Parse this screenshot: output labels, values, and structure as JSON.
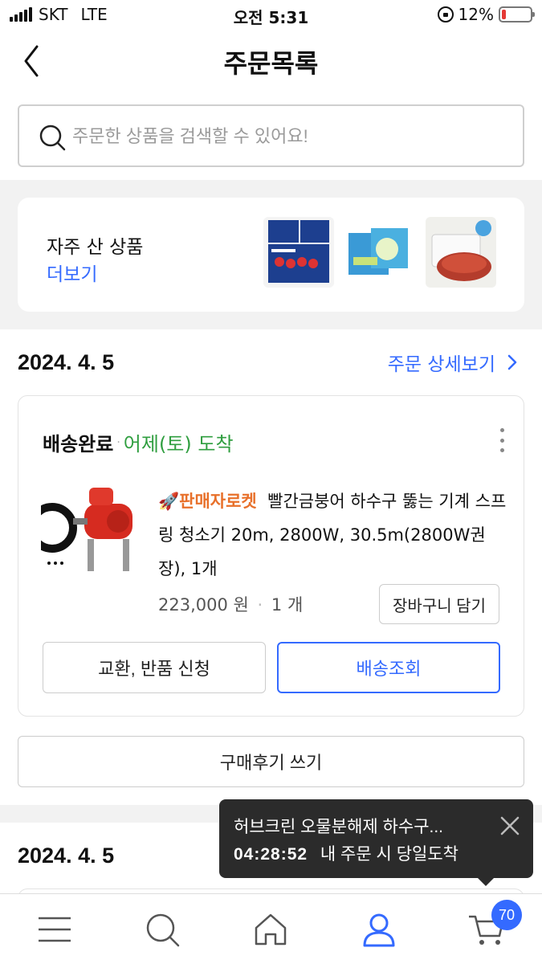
{
  "status_bar": {
    "carrier": "SKT",
    "network": "LTE",
    "time": "오전 5:31",
    "battery": "12%"
  },
  "header": {
    "title": "주문목록"
  },
  "search": {
    "placeholder": "주문한 상품을 검색할 수 있어요!"
  },
  "frequent": {
    "title": "자주 산 상품",
    "more_label": "더보기"
  },
  "order1": {
    "date": "2024. 4. 5",
    "detail_link": "주문 상세보기",
    "status": "배송완료",
    "status_sep": "·",
    "arrival": "어제(토) 도착",
    "rocket_label": "판매자로켓",
    "product_name": "빨간금붕어 하수구 뚫는 기계 스프링 청소기 20m, 2800W, 30.5m(2800W권장), 1개",
    "price": "223,000 원",
    "price_sep": "·",
    "quantity": "1 개",
    "cart_add_label": "장바구니 담기",
    "return_label": "교환, 반품 신청",
    "track_label": "배송조회",
    "review_label": "구매후기 쓰기"
  },
  "order2": {
    "date": "2024. 4. 5"
  },
  "toast": {
    "title": "허브크린 오물분해제 하수구...",
    "time": "04:28:52",
    "message": "내 주문 시 당일도착"
  },
  "bottom_nav": {
    "cart_count": "70"
  },
  "colors": {
    "accent": "#346aff",
    "arrival_green": "#2f9e3f",
    "rocket_orange": "#e8702a"
  }
}
